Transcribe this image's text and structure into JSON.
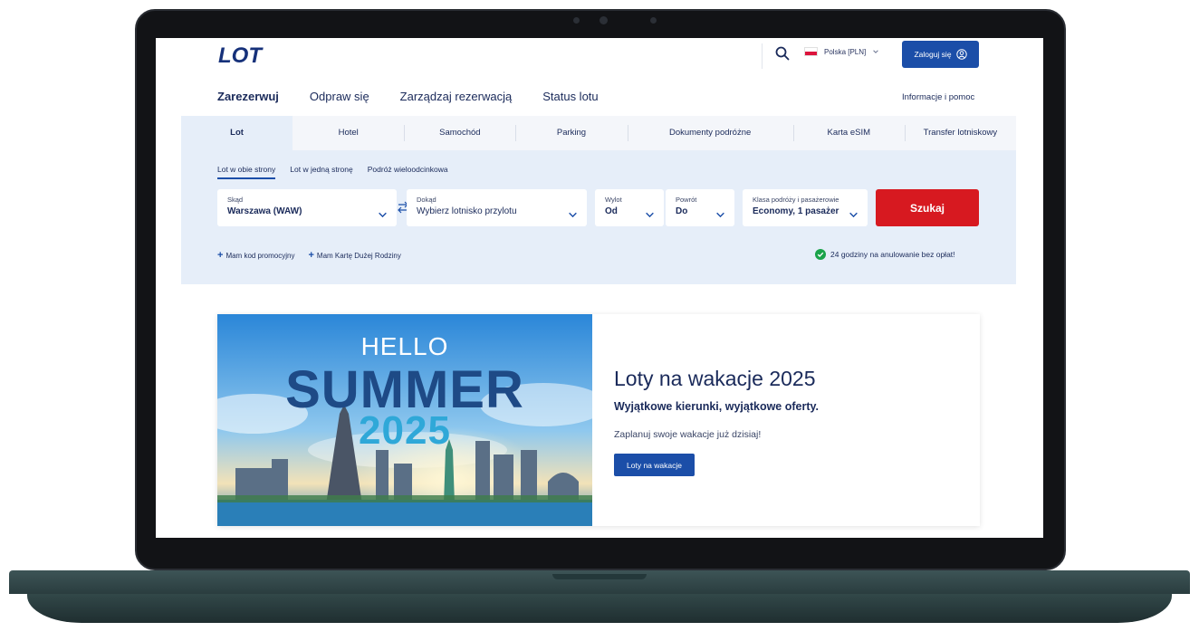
{
  "brand": {
    "logo_text": "LOT",
    "primary_color": "#1b4ea8",
    "accent_color": "#d71920"
  },
  "header": {
    "country_label": "Polska [PLN]",
    "login_label": "Zaloguj się",
    "help_label": "Informacje i pomoc"
  },
  "nav": {
    "items": [
      {
        "label": "Zarezerwuj"
      },
      {
        "label": "Odpraw się"
      },
      {
        "label": "Zarządzaj rezerwacją"
      },
      {
        "label": "Status lotu"
      }
    ]
  },
  "tabs": [
    {
      "label": "Lot"
    },
    {
      "label": "Hotel"
    },
    {
      "label": "Samochód"
    },
    {
      "label": "Parking"
    },
    {
      "label": "Dokumenty podróżne"
    },
    {
      "label": "Karta eSIM"
    },
    {
      "label": "Transfer lotniskowy"
    }
  ],
  "booking": {
    "trip_types": [
      {
        "label": "Lot w obie strony"
      },
      {
        "label": "Lot w jedną stronę"
      },
      {
        "label": "Podróż wieloodcinkowa"
      }
    ],
    "from": {
      "label": "Skąd",
      "value": "Warszawa (WAW)"
    },
    "to": {
      "label": "Dokąd",
      "value": "Wybierz lotnisko przylotu"
    },
    "depart": {
      "label": "Wylot",
      "value": "Od"
    },
    "return": {
      "label": "Powrót",
      "value": "Do"
    },
    "passengers": {
      "label": "Klasa podróży i pasażerowie",
      "value": "Economy, 1 pasażer"
    },
    "search_label": "Szukaj",
    "promo_code_label": "Mam kod promocyjny",
    "family_card_label": "Mam Kartę Dużej Rodziny",
    "cancel_note": "24 godziny na anulowanie bez opłat!"
  },
  "promo": {
    "image_text": {
      "line1": "HELLO",
      "line2": "SUMMER",
      "line3": "2025"
    },
    "title": "Loty na wakacje 2025",
    "subtitle": "Wyjątkowe kierunki, wyjątkowe oferty.",
    "text": "Zaplanuj swoje wakacje już dzisiaj!",
    "button_label": "Loty na wakacje"
  }
}
